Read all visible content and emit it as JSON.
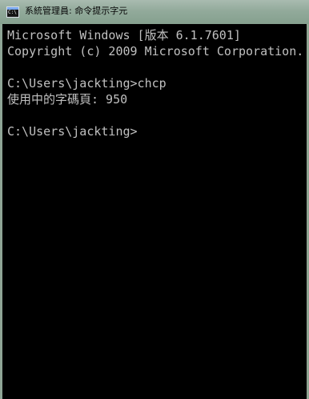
{
  "window": {
    "title": "系統管理員: 命令提示字元"
  },
  "console": {
    "lines": [
      "Microsoft Windows [版本 6.1.7601]",
      "Copyright (c) 2009 Microsoft Corporation.",
      "",
      "C:\\Users\\jackting>chcp",
      "使用中的字碼頁: 950",
      "",
      "C:\\Users\\jackting>"
    ]
  },
  "icons": {
    "title": "command-prompt-icon"
  },
  "colors": {
    "console_background": "#000000",
    "console_text": "#c0c0c0",
    "title_text": "#070707"
  }
}
